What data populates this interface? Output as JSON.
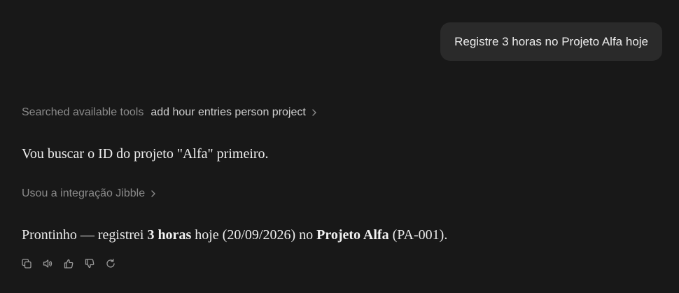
{
  "user_message": "Registre 3 horas no Projeto Alfa hoje",
  "tool_search": {
    "label": "Searched available tools",
    "query": "add hour entries person project"
  },
  "assistant_intro": "Vou buscar o ID do projeto \"Alfa\" primeiro.",
  "integration": {
    "label": "Usou a integração Jibble"
  },
  "assistant_result": {
    "part1": "Prontinho — registrei ",
    "bold1": "3 horas",
    "part2": " hoje (20/09/2026) no ",
    "bold2": "Projeto Alfa",
    "part3": " (PA-001)."
  },
  "actions": [
    "copy-icon",
    "speaker-icon",
    "thumbs-up-icon",
    "thumbs-down-icon",
    "retry-icon"
  ],
  "colors": {
    "background": "#181818",
    "bubble": "#2a2a2a",
    "muted_text": "#8b8b8b"
  }
}
